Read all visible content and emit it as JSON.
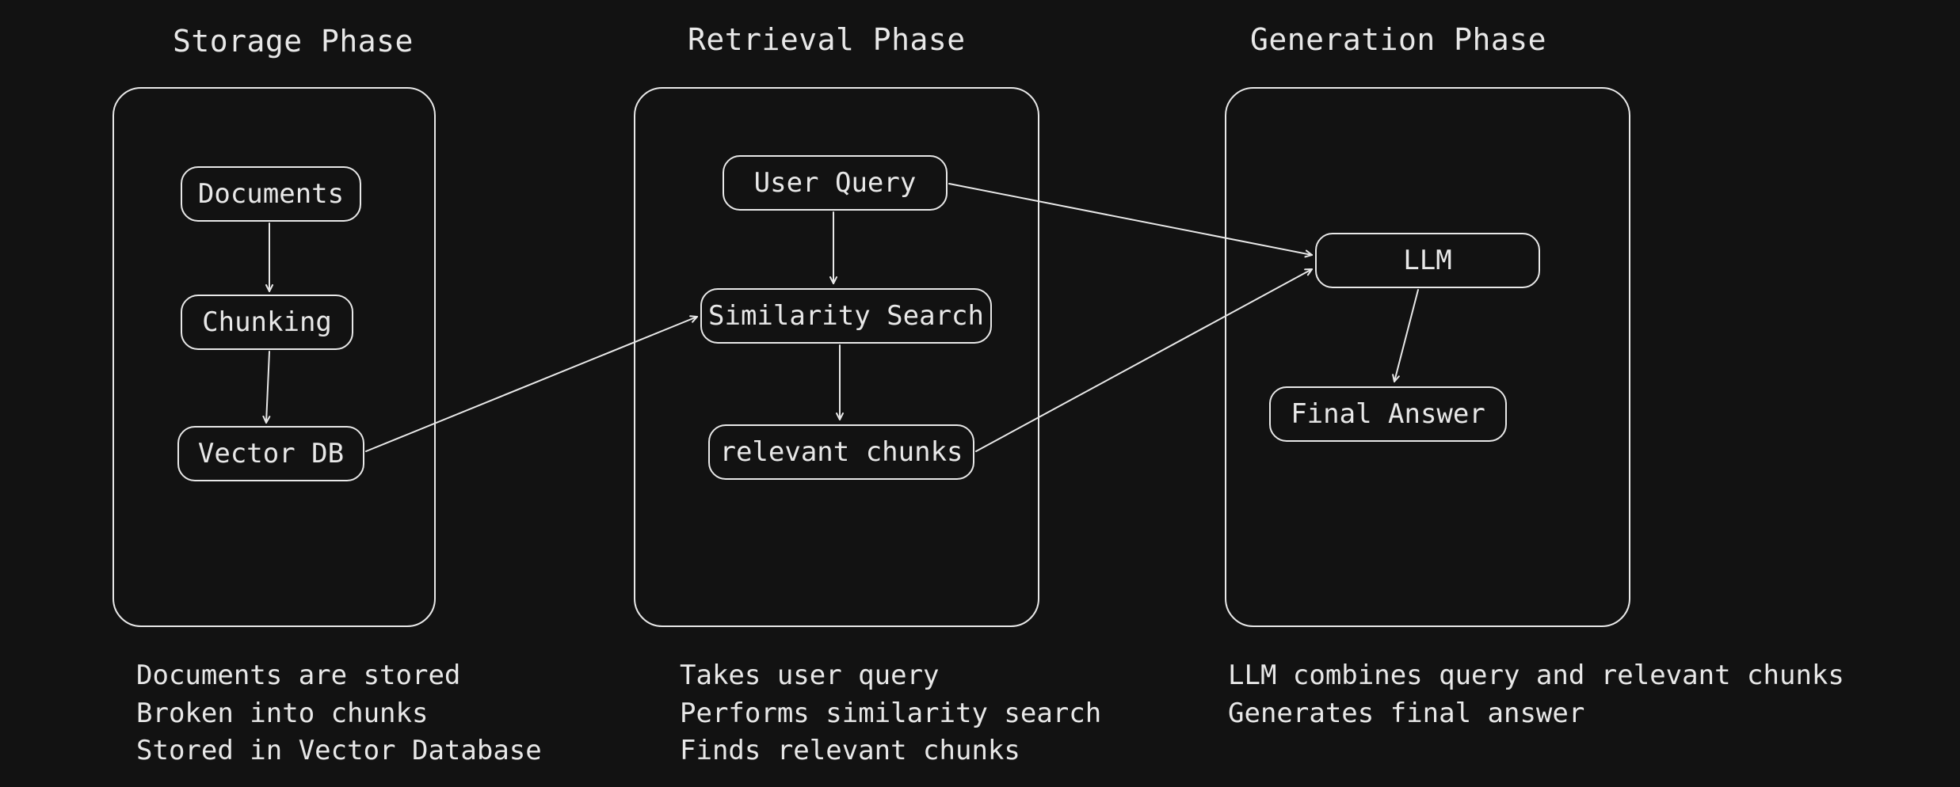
{
  "phases": {
    "storage": {
      "title": "Storage Phase",
      "nodes": {
        "documents": "Documents",
        "chunking": "Chunking",
        "vectordb": "Vector DB"
      },
      "description": "Documents are stored\nBroken into chunks\nStored in Vector Database"
    },
    "retrieval": {
      "title": "Retrieval Phase",
      "nodes": {
        "query": "User Query",
        "similarity": "Similarity Search",
        "chunks": "relevant chunks"
      },
      "description": "Takes user query\nPerforms similarity search\nFinds relevant chunks"
    },
    "generation": {
      "title": "Generation Phase",
      "nodes": {
        "llm": "LLM",
        "answer": "Final Answer"
      },
      "description": "LLM combines query and relevant chunks\nGenerates final answer"
    }
  },
  "arrows": [
    {
      "name": "documents-to-chunking",
      "from": "phases.storage.nodes.documents",
      "to": "phases.storage.nodes.chunking"
    },
    {
      "name": "chunking-to-vectordb",
      "from": "phases.storage.nodes.chunking",
      "to": "phases.storage.nodes.vectordb"
    },
    {
      "name": "vectordb-to-similarity",
      "from": "phases.storage.nodes.vectordb",
      "to": "phases.retrieval.nodes.similarity"
    },
    {
      "name": "query-to-similarity",
      "from": "phases.retrieval.nodes.query",
      "to": "phases.retrieval.nodes.similarity"
    },
    {
      "name": "similarity-to-chunks",
      "from": "phases.retrieval.nodes.similarity",
      "to": "phases.retrieval.nodes.chunks"
    },
    {
      "name": "query-to-llm",
      "from": "phases.retrieval.nodes.query",
      "to": "phases.generation.nodes.llm"
    },
    {
      "name": "chunks-to-llm",
      "from": "phases.retrieval.nodes.chunks",
      "to": "phases.generation.nodes.llm"
    },
    {
      "name": "llm-to-answer",
      "from": "phases.generation.nodes.llm",
      "to": "phases.generation.nodes.answer"
    }
  ],
  "colors": {
    "bg": "#121212",
    "fg": "#e8e8e8"
  }
}
